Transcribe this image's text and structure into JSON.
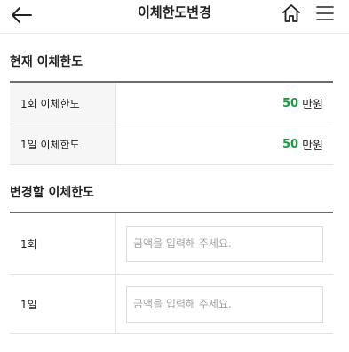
{
  "header": {
    "title": "이체한도변경",
    "back_icon": "back-arrow-icon",
    "home_icon": "home-icon",
    "menu_icon": "hamburger-menu-icon"
  },
  "current_limit": {
    "section_title": "현재 이체한도",
    "rows": [
      {
        "label": "1회 이체한도",
        "amount": "50",
        "unit": "만원"
      },
      {
        "label": "1일 이체한도",
        "amount": "50",
        "unit": "만원"
      }
    ]
  },
  "change_limit": {
    "section_title": "변경할 이체한도",
    "rows": [
      {
        "label": "1회",
        "placeholder": "금액을 입력해 주세요.",
        "value": ""
      },
      {
        "label": "1일",
        "placeholder": "금액을 입력해 주세요.",
        "value": ""
      }
    ]
  },
  "colors": {
    "amount_green": "#1a9a3c",
    "table_border": "#6d6d6d",
    "label_bg": "#f6f6f6"
  }
}
